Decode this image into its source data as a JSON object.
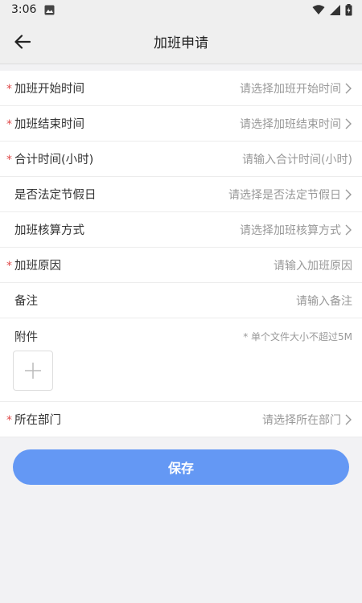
{
  "status": {
    "time": "3:06"
  },
  "header": {
    "title": "加班申请"
  },
  "fields": [
    {
      "label": "加班开始时间",
      "placeholder": "请选择加班开始时间",
      "required": true,
      "chevron": true
    },
    {
      "label": "加班结束时间",
      "placeholder": "请选择加班结束时间",
      "required": true,
      "chevron": true
    },
    {
      "label": "合计时间(小时)",
      "placeholder": "请输入合计时间(小时)",
      "required": true,
      "chevron": false
    },
    {
      "label": "是否法定节假日",
      "placeholder": "请选择是否法定节假日",
      "required": false,
      "chevron": true
    },
    {
      "label": "加班核算方式",
      "placeholder": "请选择加班核算方式",
      "required": false,
      "chevron": true
    },
    {
      "label": "加班原因",
      "placeholder": "请输入加班原因",
      "required": true,
      "chevron": false
    },
    {
      "label": "备注",
      "placeholder": "请输入备注",
      "required": false,
      "chevron": false
    }
  ],
  "attachment": {
    "label": "附件",
    "hint": "* 单个文件大小不超过5M",
    "add_icon": "plus-icon"
  },
  "department": {
    "label": "所在部门",
    "placeholder": "请选择所在部门",
    "required": true,
    "chevron": true
  },
  "actions": {
    "save_label": "保存"
  },
  "colors": {
    "accent": "#6498f4",
    "required": "#e04b4b",
    "placeholder": "#999999"
  }
}
